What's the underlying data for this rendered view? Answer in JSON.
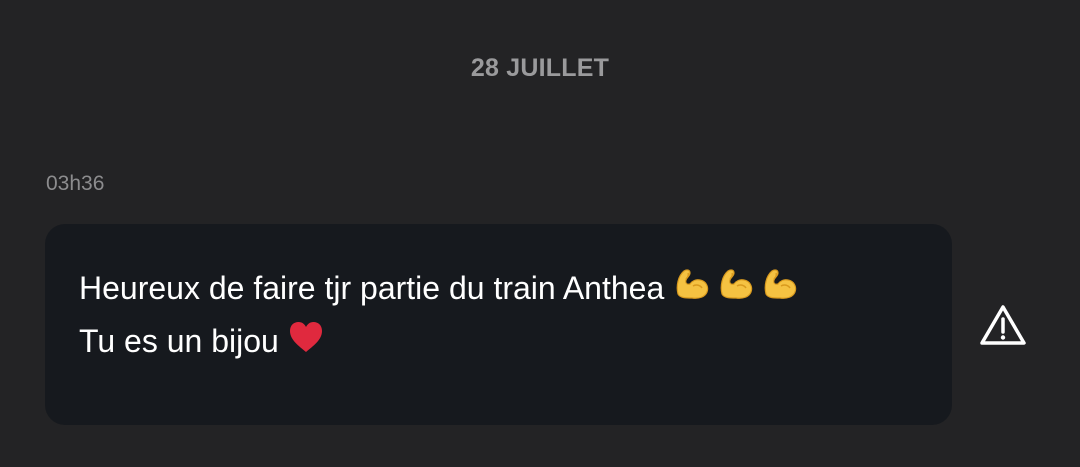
{
  "conversation": {
    "date_divider": "28 JUILLET",
    "message": {
      "time": "03h36",
      "line1": "Heureux de faire tjr partie du train Anthea",
      "line1_emojis": [
        "flexed-biceps-emoji",
        "flexed-biceps-emoji",
        "flexed-biceps-emoji"
      ],
      "line2": "Tu es un bijou",
      "line2_emojis": [
        "red-heart-emoji"
      ]
    },
    "report_icon": "warning-triangle-icon"
  },
  "colors": {
    "background": "#232325",
    "bubble": "#16191e",
    "text": "#ffffff",
    "muted": "#9a9a9c",
    "emoji_yellow": "#f5c242",
    "heart_red": "#e0293e"
  }
}
